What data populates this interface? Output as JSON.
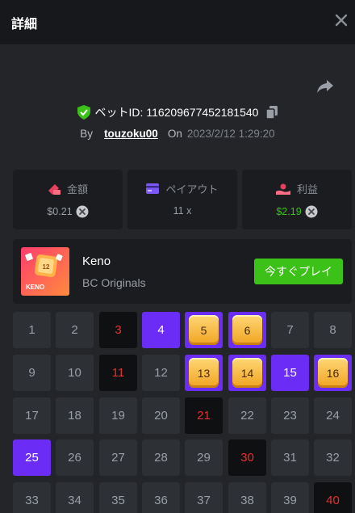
{
  "header": {
    "title": "詳細"
  },
  "bet": {
    "id_label": "ベットID: 116209677452181540",
    "by_label": "By",
    "user": "touzoku00",
    "on_label": "On",
    "date": "2023/2/12 1:29:20"
  },
  "stats": [
    {
      "label": "金額",
      "value": "$0.21",
      "icon": "wallet-icon"
    },
    {
      "label": "ペイアウト",
      "value": "11 x",
      "icon": "card-icon"
    },
    {
      "label": "利益",
      "value": "$2.19",
      "icon": "profit-icon"
    }
  ],
  "game": {
    "name": "Keno",
    "provider": "BC Originals",
    "play_label": "今すぐプレイ",
    "thumb_text": "KENO",
    "thumb_number": "12"
  },
  "colors": {
    "win": "#3bc117",
    "miss": "#e5302f",
    "pick": "#6b2df5",
    "accent": "#3bc117"
  },
  "keno": {
    "cells": [
      {
        "n": "1",
        "s": "normal"
      },
      {
        "n": "2",
        "s": "normal"
      },
      {
        "n": "3",
        "s": "miss"
      },
      {
        "n": "4",
        "s": "pick"
      },
      {
        "n": "5",
        "s": "hit"
      },
      {
        "n": "6",
        "s": "hit"
      },
      {
        "n": "7",
        "s": "normal"
      },
      {
        "n": "8",
        "s": "normal"
      },
      {
        "n": "9",
        "s": "normal"
      },
      {
        "n": "10",
        "s": "normal"
      },
      {
        "n": "11",
        "s": "miss"
      },
      {
        "n": "12",
        "s": "normal"
      },
      {
        "n": "13",
        "s": "hit"
      },
      {
        "n": "14",
        "s": "hit"
      },
      {
        "n": "15",
        "s": "pick"
      },
      {
        "n": "16",
        "s": "hit"
      },
      {
        "n": "17",
        "s": "normal"
      },
      {
        "n": "18",
        "s": "normal"
      },
      {
        "n": "19",
        "s": "normal"
      },
      {
        "n": "20",
        "s": "normal"
      },
      {
        "n": "21",
        "s": "miss"
      },
      {
        "n": "22",
        "s": "normal"
      },
      {
        "n": "23",
        "s": "normal"
      },
      {
        "n": "24",
        "s": "normal"
      },
      {
        "n": "25",
        "s": "pick"
      },
      {
        "n": "26",
        "s": "normal"
      },
      {
        "n": "27",
        "s": "normal"
      },
      {
        "n": "28",
        "s": "normal"
      },
      {
        "n": "29",
        "s": "normal"
      },
      {
        "n": "30",
        "s": "miss"
      },
      {
        "n": "31",
        "s": "normal"
      },
      {
        "n": "32",
        "s": "normal"
      },
      {
        "n": "33",
        "s": "normal"
      },
      {
        "n": "34",
        "s": "normal"
      },
      {
        "n": "35",
        "s": "normal"
      },
      {
        "n": "36",
        "s": "normal"
      },
      {
        "n": "37",
        "s": "normal"
      },
      {
        "n": "38",
        "s": "normal"
      },
      {
        "n": "39",
        "s": "normal"
      },
      {
        "n": "40",
        "s": "miss"
      }
    ]
  }
}
